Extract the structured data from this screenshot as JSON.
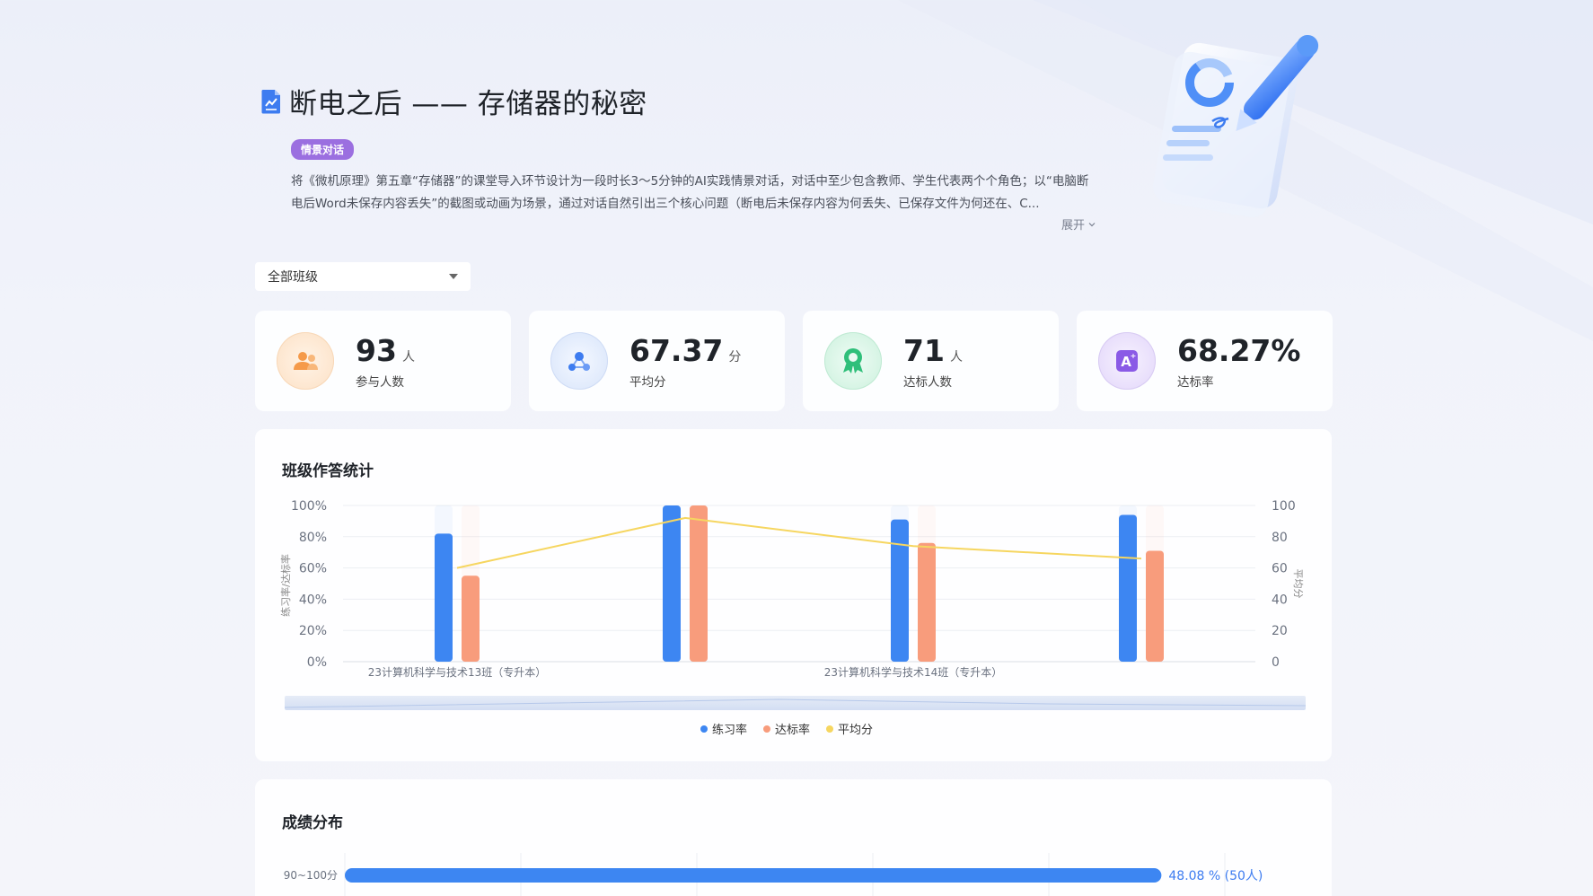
{
  "header": {
    "title": "断电之后 —— 存储器的秘密",
    "tag": "情景对话",
    "description": "将《微机原理》第五章“存储器”的课堂导入环节设计为一段时长3～5分钟的AI实践情景对话，对话中至少包含教师、学生代表两个个角色；以“电脑断电后Word未保存内容丢失”的截图或动画为场景，通过对话自然引出三个核心问题（断电后未保存内容为何丢失、已保存文件为何还在、C...",
    "expand_label": "展开"
  },
  "filter": {
    "class_select_value": "全部班级"
  },
  "stats": [
    {
      "value": "93",
      "unit": "人",
      "label": "参与人数",
      "icon": "people-icon",
      "color": "#f59a4a"
    },
    {
      "value": "67.37",
      "unit": "分",
      "label": "平均分",
      "icon": "nodes-icon",
      "color": "#3d7cf0"
    },
    {
      "value": "71",
      "unit": "人",
      "label": "达标人数",
      "icon": "award-icon",
      "color": "#2fbf7a"
    },
    {
      "value": "68.27%",
      "unit": "",
      "label": "达标率",
      "icon": "grade-a-icon",
      "color": "#8a5ae6"
    }
  ],
  "class_stats_panel": {
    "title": "班级作答统计"
  },
  "chart_data": {
    "type": "bar",
    "title": "班级作答统计",
    "ylabel": "练习率/达标率",
    "y2label": "平均分",
    "ylim": [
      0,
      100
    ],
    "y2lim": [
      0,
      100
    ],
    "y_ticks": [
      "0%",
      "20%",
      "40%",
      "60%",
      "80%",
      "100%"
    ],
    "y2_ticks": [
      "0",
      "20",
      "40",
      "60",
      "80",
      "100"
    ],
    "categories": [
      "23计算机科学与技术13班（专升本）",
      "",
      "23计算机科学与技术14班（专升本）",
      ""
    ],
    "series": [
      {
        "name": "练习率",
        "type": "bar",
        "color": "#3d86f2",
        "values": [
          82,
          100,
          91,
          94
        ]
      },
      {
        "name": "达标率",
        "type": "bar",
        "color": "#f89c7c",
        "values": [
          55,
          100,
          76,
          71
        ]
      },
      {
        "name": "平均分",
        "type": "line",
        "color": "#f6d660",
        "values": [
          60,
          92,
          74,
          66
        ]
      }
    ],
    "legend_position": "bottom-center",
    "grid": true
  },
  "grade_panel": {
    "title": "成绩分布",
    "rows": [
      {
        "range": "90~100分",
        "label": "48.08 % (50人)",
        "fraction": 0.4808
      }
    ]
  }
}
